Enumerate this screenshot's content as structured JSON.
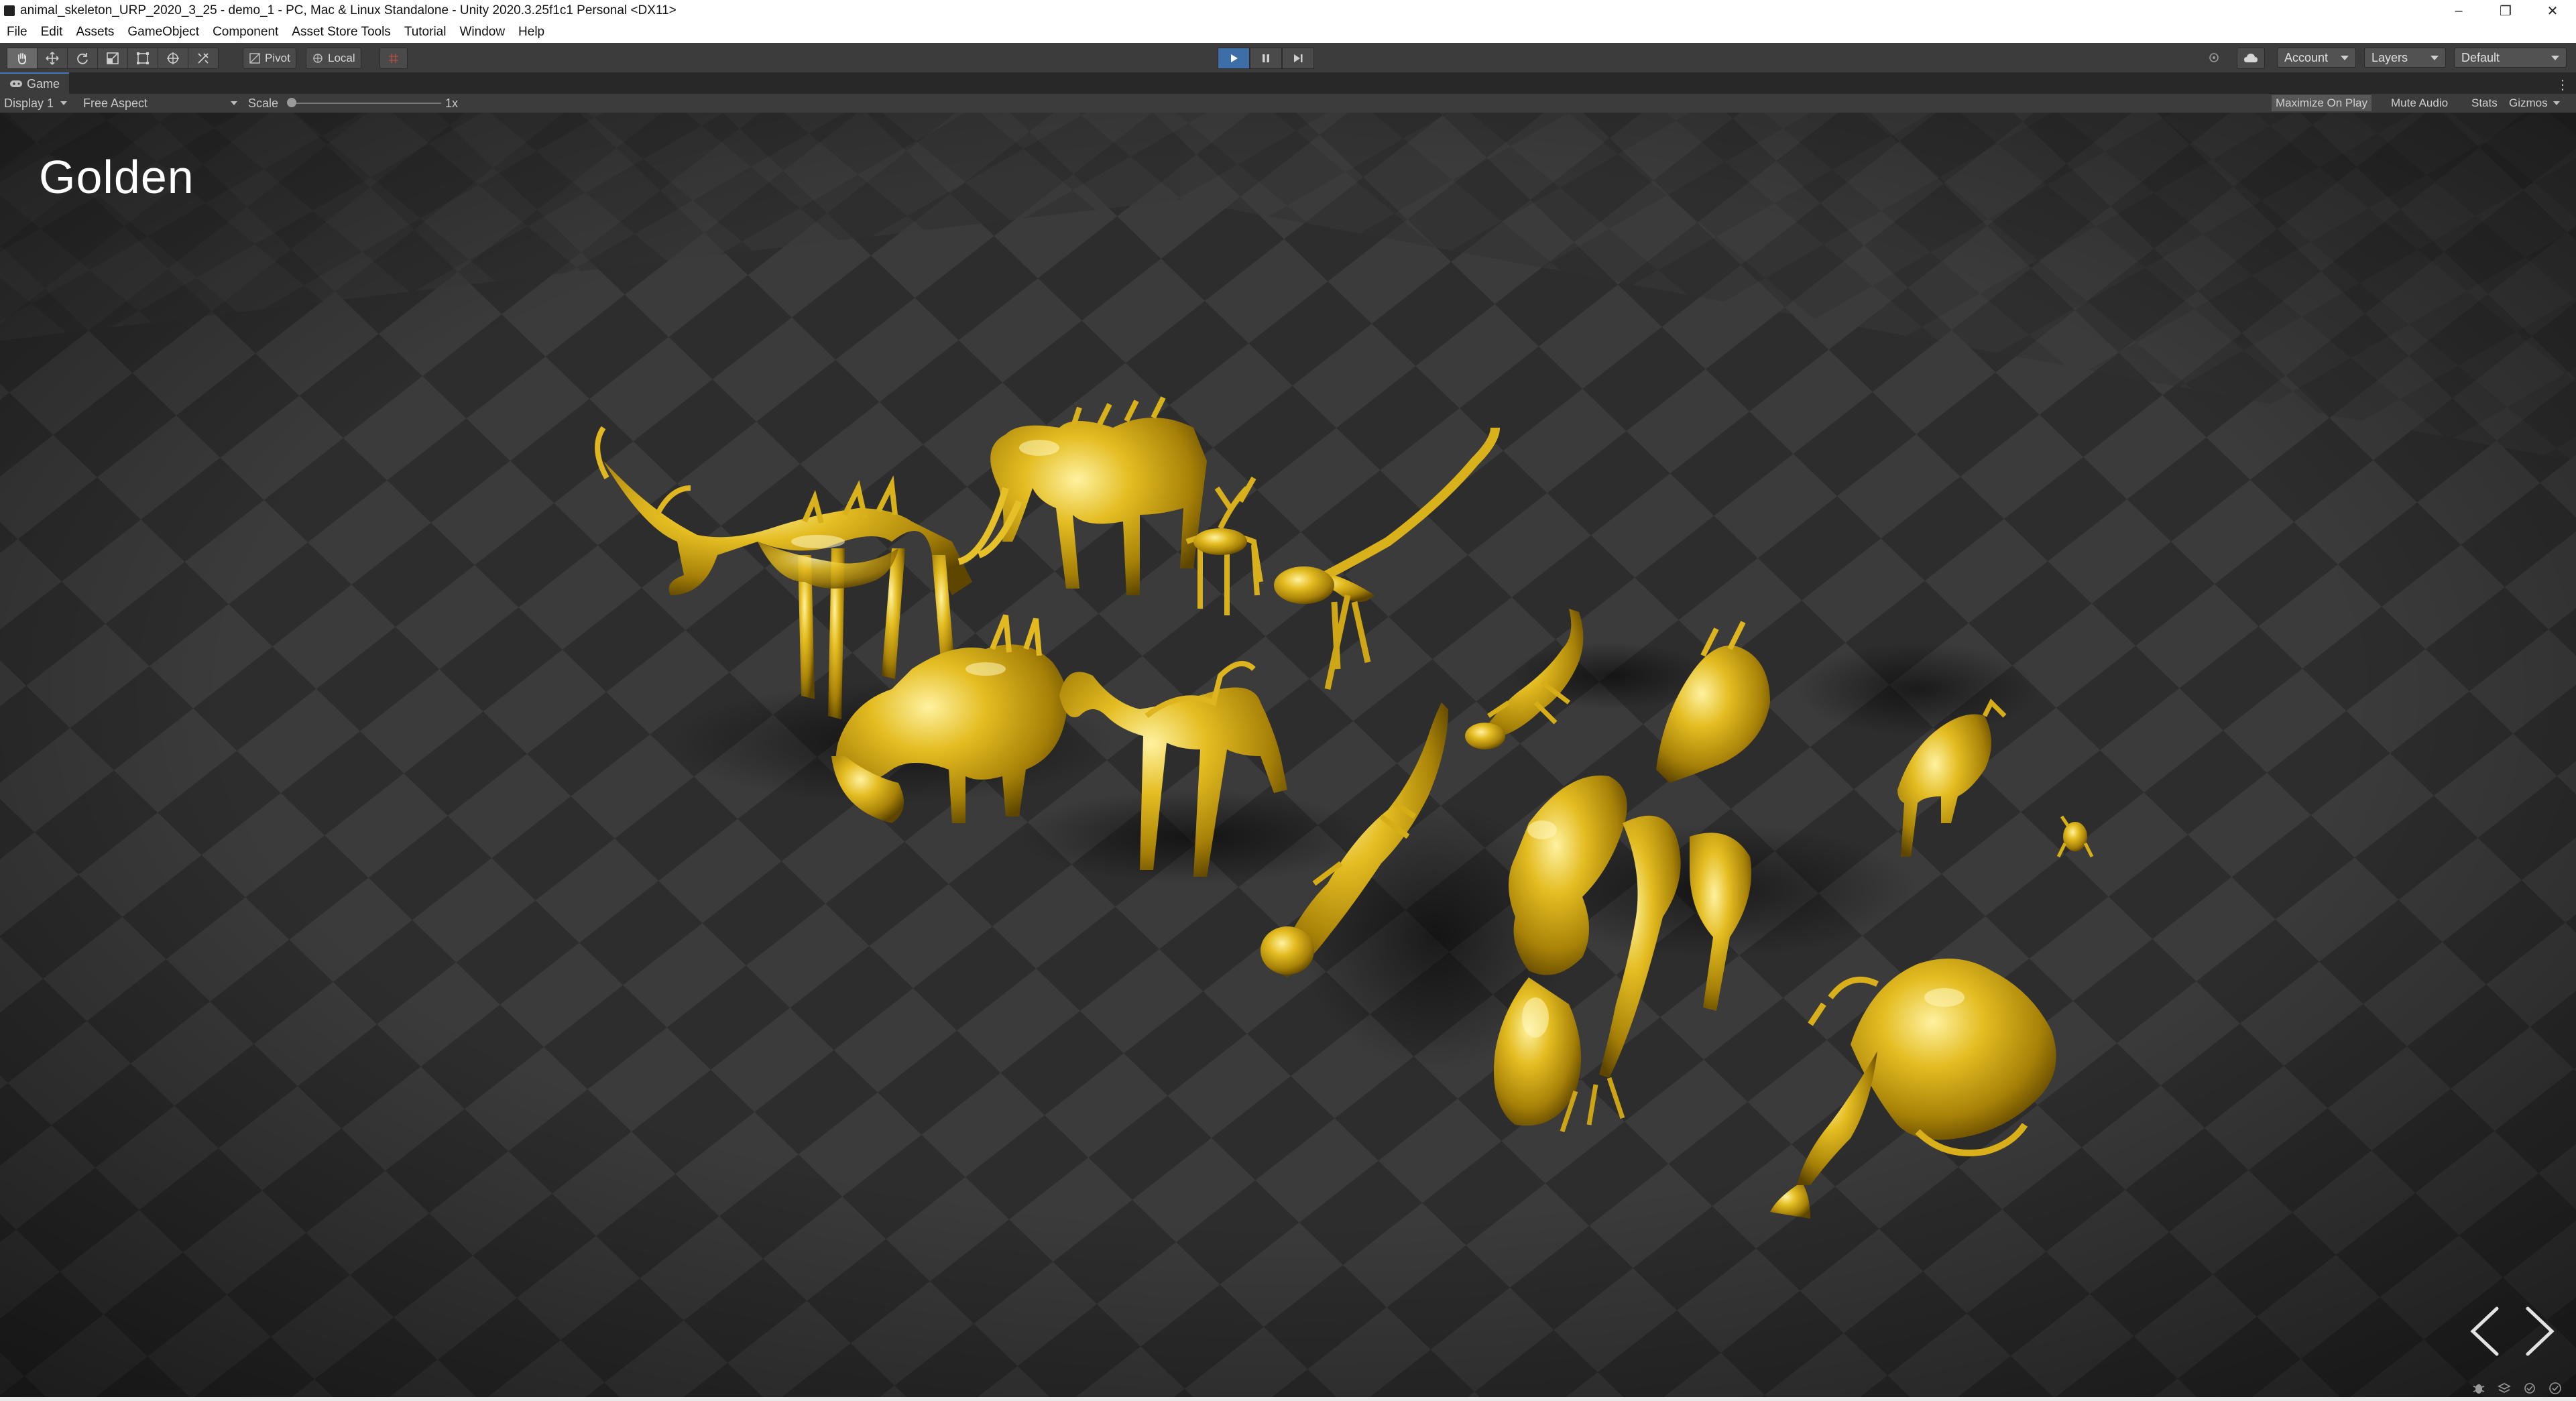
{
  "window": {
    "title": "animal_skeleton_URP_2020_3_25 - demo_1 - PC, Mac & Linux Standalone - Unity 2020.3.25f1c1 Personal <DX11>",
    "minimize_glyph": "–",
    "restore_glyph": "❐",
    "close_glyph": "✕"
  },
  "menu": {
    "items": [
      "File",
      "Edit",
      "Assets",
      "GameObject",
      "Component",
      "Asset Store Tools",
      "Tutorial",
      "Window",
      "Help"
    ]
  },
  "toolbar": {
    "tools": [
      {
        "icon": "hand-tool-icon",
        "active": true
      },
      {
        "icon": "move-tool-icon",
        "active": false
      },
      {
        "icon": "rotate-tool-icon",
        "active": false
      },
      {
        "icon": "scale-tool-icon",
        "active": false
      },
      {
        "icon": "rect-tool-icon",
        "active": false
      },
      {
        "icon": "transform-tool-icon",
        "active": false
      },
      {
        "icon": "custom-tool-icon",
        "active": false
      }
    ],
    "pivot_label": "Pivot",
    "local_label": "Local",
    "grid_icon": "grid-snap-icon",
    "play_active": true,
    "account_label": "Account",
    "layers_label": "Layers",
    "layout_label": "Default",
    "accent_color": "#3e6ea8"
  },
  "game_view": {
    "tab_label": "Game",
    "display_label": "Display 1",
    "aspect_label": "Free Aspect",
    "scale_label": "Scale",
    "scale_value": "1x",
    "maximize_label": "Maximize On Play",
    "mute_label": "Mute Audio",
    "stats_label": "Stats",
    "gizmos_label": "Gizmos",
    "maximize_active": true
  },
  "scene": {
    "title": "Golden",
    "material_color": "#d6ad18",
    "floor_light": "#3a3a3a",
    "floor_dark": "#2a2a2a",
    "prev_icon": "chevron-left-icon",
    "next_icon": "chevron-right-icon"
  }
}
